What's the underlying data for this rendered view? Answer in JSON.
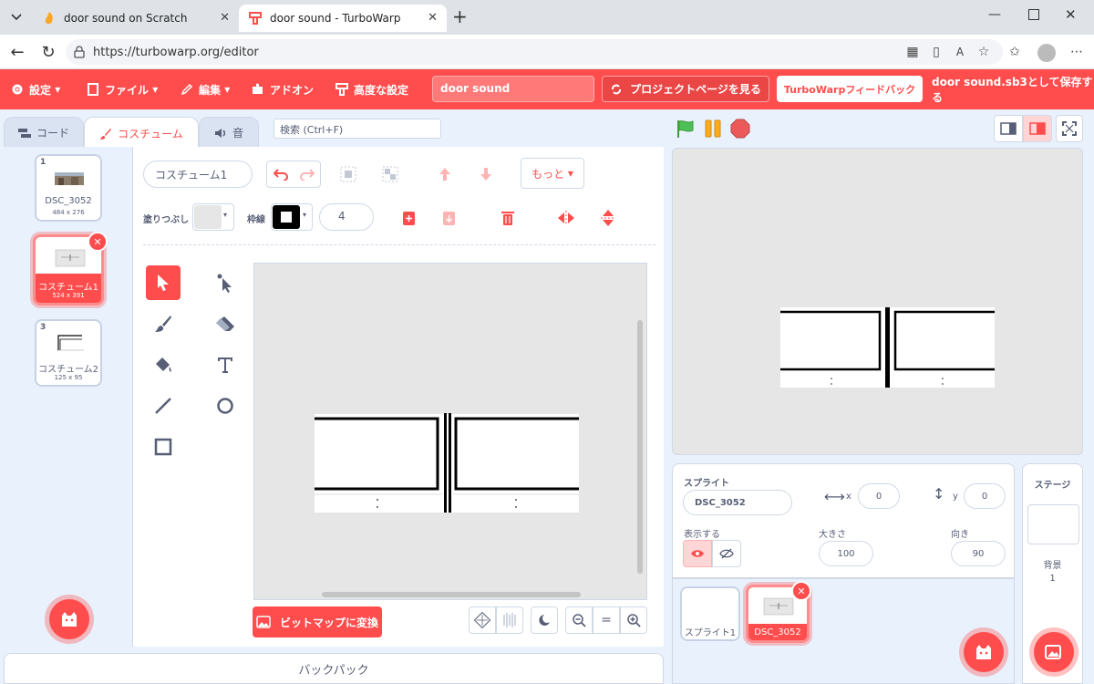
{
  "browser": {
    "tabs": [
      {
        "title": "door sound on Scratch",
        "active": false
      },
      {
        "title": "door sound - TurboWarp",
        "active": true
      }
    ],
    "url": "https://turbowarp.org/editor"
  },
  "menubar": {
    "settings": "設定",
    "file": "ファイル",
    "edit": "編集",
    "addons": "アドオン",
    "advanced": "高度な設定",
    "project_title": "door sound",
    "project_page": "プロジェクトページを見る",
    "feedback": "TurboWarpフィードバック",
    "save": "door sound.sb3として保存する"
  },
  "editor_tabs": {
    "code": "コード",
    "costumes": "コスチューム",
    "sounds": "音"
  },
  "search_placeholder": "検索 (Ctrl+F)",
  "costumes": [
    {
      "num": "1",
      "name": "DSC_3052",
      "size": "484 x 276"
    },
    {
      "num": "2",
      "name": "コスチューム1",
      "size": "524 x 391"
    },
    {
      "num": "3",
      "name": "コスチューム2",
      "size": "125 x 95"
    }
  ],
  "paint": {
    "costume_name": "コスチューム1",
    "more": "もっと",
    "fill_label": "塗りつぶし",
    "outline_label": "枠線",
    "outline_width": "4",
    "convert_bitmap": "ビットマップに変換"
  },
  "backpack": "バックパック",
  "sprite_info": {
    "sprite_label": "スプライト",
    "sprite_name": "DSC_3052",
    "x_label": "x",
    "x": "0",
    "y_label": "y",
    "y": "0",
    "show_label": "表示する",
    "size_label": "大きさ",
    "size": "100",
    "direction_label": "向き",
    "direction": "90"
  },
  "sprites": [
    {
      "name": "スプライト1"
    },
    {
      "name": "DSC_3052"
    }
  ],
  "stage_panel": {
    "title": "ステージ",
    "backdrop_label": "背景",
    "backdrop_count": "1"
  },
  "colors": {
    "accent": "#ff4c4c",
    "blue_bg": "#e9f1fc",
    "text": "#575e75"
  }
}
